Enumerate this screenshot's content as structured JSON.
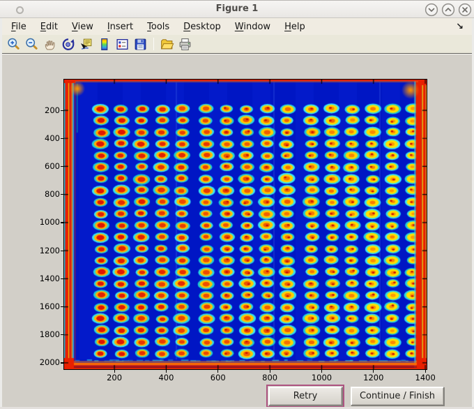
{
  "window": {
    "title": "Figure 1",
    "controls": [
      {
        "name": "minimize",
        "glyph": "chevron-down"
      },
      {
        "name": "maximize",
        "glyph": "chevron-up"
      },
      {
        "name": "close",
        "glyph": "x"
      }
    ]
  },
  "menu_bar": {
    "items": [
      {
        "label": "File",
        "accel_index": 0
      },
      {
        "label": "Edit",
        "accel_index": 0
      },
      {
        "label": "View",
        "accel_index": 0
      },
      {
        "label": "Insert",
        "accel_index": 0
      },
      {
        "label": "Tools",
        "accel_index": 0
      },
      {
        "label": "Desktop",
        "accel_index": 0
      },
      {
        "label": "Window",
        "accel_index": 0
      },
      {
        "label": "Help",
        "accel_index": 0
      }
    ],
    "overflow_glyph": "↘"
  },
  "toolbar": {
    "tools": [
      "zoom-in",
      "zoom-out",
      "pan",
      "rotate-3d",
      "data-cursor",
      "colorbar",
      "legend",
      "save",
      "separator",
      "open-file",
      "print"
    ]
  },
  "plot": {
    "type": "heatmap",
    "colormap": "jet",
    "description": "Intensity scan of a plate: 16 columns x 22 rows of warm red/yellow spots with cyan halos on a blue field, hot red band around all four edges",
    "x_axis": {
      "min": 6,
      "max": 1405,
      "ticks": [
        200,
        400,
        600,
        800,
        1000,
        1200,
        1400
      ]
    },
    "y_axis": {
      "min": -19,
      "max": 2045,
      "ticks": [
        200,
        400,
        600,
        800,
        1000,
        1200,
        1400,
        1600,
        1800,
        2000
      ]
    },
    "spots": {
      "rows": 22,
      "cols": 16,
      "col_start": 53,
      "col_spacing": 29,
      "extra_gap_after": [
        5,
        10
      ],
      "extra_gap": 6,
      "row_start": 42,
      "row_spacing": 16.7
    },
    "colors": {
      "background": "#0016c4",
      "halo": "#2cd8e2",
      "ring_left": "#ffae00",
      "ring_right": "#ffe100",
      "core_left": "#e01400",
      "core_right": "#ff9c00",
      "speck": "#c81000",
      "frame_red": "#e82000",
      "frame_orange": "#ff8800",
      "frame_yellow": "#ffc800",
      "frame_cyan": "#38d8e8",
      "frame_dark_red": "#9c0400"
    }
  },
  "action_bar": {
    "retry": {
      "label": "Retry",
      "focused": true,
      "focus_ring_color": "#ad5380"
    },
    "continue": {
      "label": "Continue / Finish"
    }
  }
}
